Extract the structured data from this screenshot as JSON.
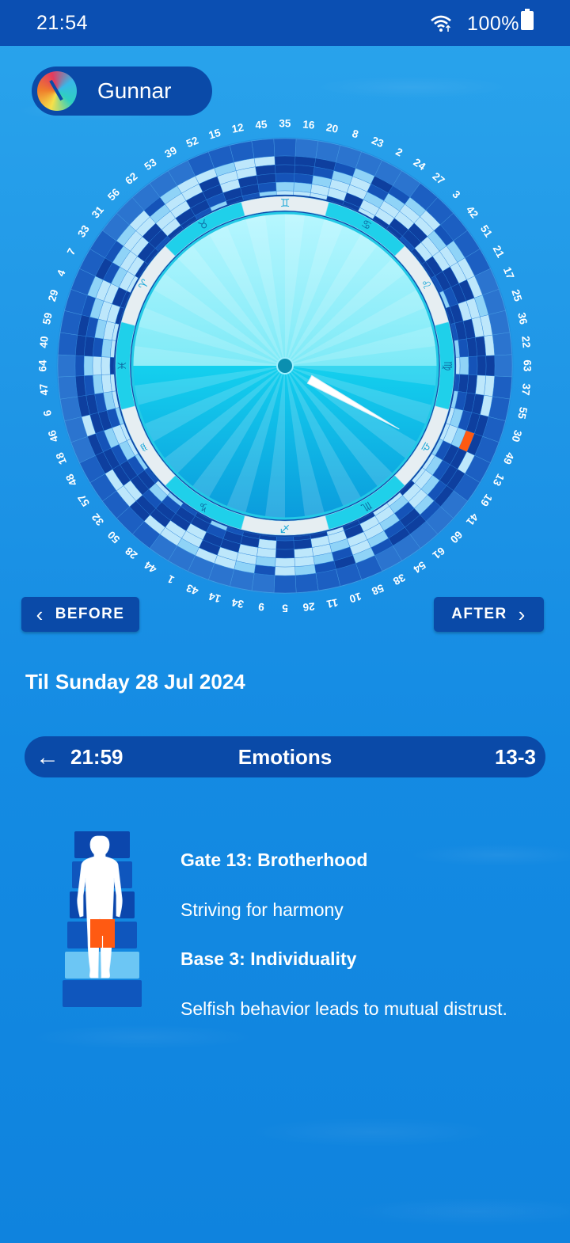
{
  "status_bar": {
    "time": "21:54",
    "battery": "100%"
  },
  "profile": {
    "name": "Gunnar"
  },
  "wheel": {
    "gate_numbers_clockwise_from_top": [
      "16",
      "20",
      "8",
      "23",
      "2",
      "24",
      "27",
      "3",
      "42",
      "51",
      "21",
      "17",
      "25",
      "36",
      "22",
      "63",
      "37",
      "55",
      "30",
      "49",
      "13",
      "19",
      "41",
      "60",
      "61",
      "54",
      "38",
      "58",
      "10",
      "11",
      "26",
      "5",
      "9",
      "34",
      "14",
      "43",
      "1",
      "44",
      "28",
      "50",
      "32",
      "57",
      "48",
      "18",
      "46",
      "6",
      "47",
      "64",
      "40",
      "59",
      "29",
      "4",
      "7",
      "33",
      "31",
      "56",
      "62",
      "53",
      "39",
      "52",
      "15",
      "12",
      "45",
      "35"
    ],
    "zodiac_glyphs": [
      "♊",
      "♉",
      "♈",
      "♓",
      "♒",
      "♑",
      "♐",
      "♏",
      "♎",
      "♍",
      "♌",
      "♋"
    ],
    "highlight_color": "#ff5a12",
    "pointer_angle_deg": 119
  },
  "nav": {
    "before_label": "BEFORE",
    "after_label": "AFTER"
  },
  "til": {
    "prefix": "Til",
    "date": "Sunday 28 Jul 2024"
  },
  "bar": {
    "time": "21:59",
    "title": "Emotions",
    "code": "13-3"
  },
  "info": {
    "gate_title": "Gate 13: Brotherhood",
    "gate_desc": "Striving for harmony",
    "base_title": "Base 3: Individuality",
    "base_desc": "Selfish behavior leads to mutual distrust."
  },
  "figure": {
    "highlight_level": 3,
    "levels": 6,
    "highlight_color": "#ff5a12"
  }
}
